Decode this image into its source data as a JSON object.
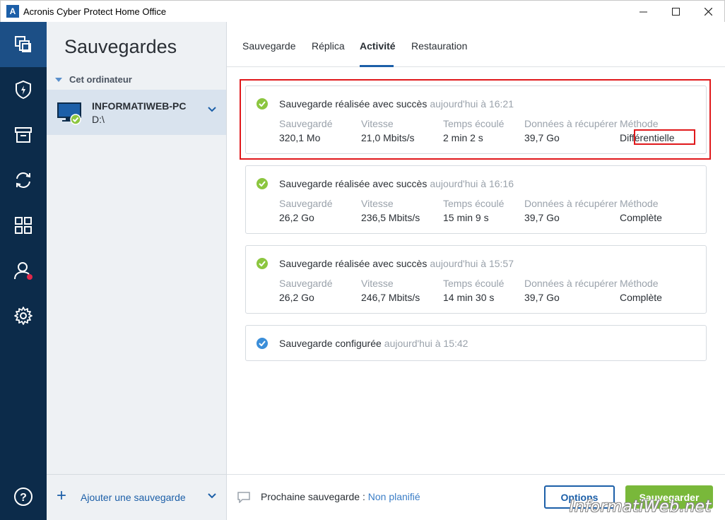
{
  "window": {
    "title": "Acronis Cyber Protect Home Office",
    "logo_letter": "A"
  },
  "colors": {
    "rail": "#0c2b4a",
    "accent": "#1c5fa8",
    "success": "#8cc63f",
    "info": "#3b8ed9",
    "highlight": "#e0181b",
    "save_button": "#79b83a"
  },
  "rail": {
    "items": [
      {
        "icon": "backup-icon",
        "active": true
      },
      {
        "icon": "shield-icon"
      },
      {
        "icon": "archive-icon"
      },
      {
        "icon": "sync-icon"
      },
      {
        "icon": "grid-icon"
      },
      {
        "icon": "account-icon"
      },
      {
        "icon": "gear-icon"
      },
      {
        "icon": "help-icon"
      }
    ]
  },
  "sidebar": {
    "title": "Sauvegardes",
    "group_label": "Cet ordinateur",
    "backup": {
      "name": "INFORMATIWEB-PC",
      "drive": "D:\\"
    },
    "add_label": "Ajouter une sauvegarde"
  },
  "tabs": [
    {
      "label": "Sauvegarde"
    },
    {
      "label": "Réplica"
    },
    {
      "label": "Activité",
      "active": true
    },
    {
      "label": "Restauration"
    }
  ],
  "activity": [
    {
      "status": "Sauvegarde réalisée avec succès",
      "time": "aujourd'hui à 16:21",
      "stats": [
        {
          "label": "Sauvegardé",
          "value": "320,1 Mo"
        },
        {
          "label": "Vitesse",
          "value": "21,0 Mbits/s"
        },
        {
          "label": "Temps écoulé",
          "value": "2 min 2 s"
        },
        {
          "label": "Données à récupérer",
          "value": "39,7 Go"
        },
        {
          "label": "Méthode",
          "value": "Différentielle"
        }
      ]
    },
    {
      "status": "Sauvegarde réalisée avec succès",
      "time": "aujourd'hui à 16:16",
      "stats": [
        {
          "label": "Sauvegardé",
          "value": "26,2 Go"
        },
        {
          "label": "Vitesse",
          "value": "236,5 Mbits/s"
        },
        {
          "label": "Temps écoulé",
          "value": "15 min 9 s"
        },
        {
          "label": "Données à récupérer",
          "value": "39,7 Go"
        },
        {
          "label": "Méthode",
          "value": "Complète"
        }
      ]
    },
    {
      "status": "Sauvegarde réalisée avec succès",
      "time": "aujourd'hui à 15:57",
      "stats": [
        {
          "label": "Sauvegardé",
          "value": "26,2 Go"
        },
        {
          "label": "Vitesse",
          "value": "246,7 Mbits/s"
        },
        {
          "label": "Temps écoulé",
          "value": "14 min 30 s"
        },
        {
          "label": "Données à récupérer",
          "value": "39,7 Go"
        },
        {
          "label": "Méthode",
          "value": "Complète"
        }
      ]
    },
    {
      "status": "Sauvegarde configurée",
      "time": "aujourd'hui à 15:42"
    }
  ],
  "footer": {
    "next_label": "Prochaine sauvegarde :",
    "next_value": "Non planifié",
    "options_label": "Options",
    "save_label": "Sauvegarder"
  },
  "watermark": "InformatiWeb.net"
}
